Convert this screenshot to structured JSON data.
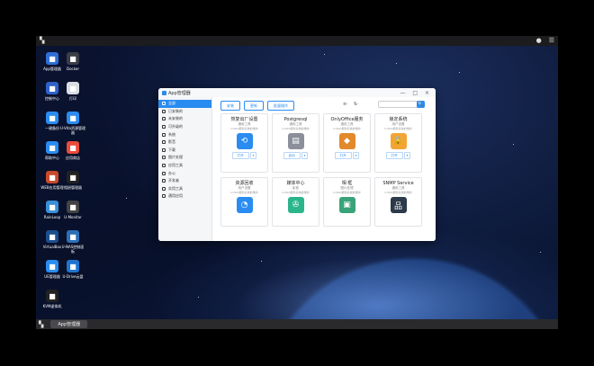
{
  "topbar": {
    "menu_icon": "apps-grid-icon",
    "user_icon": "user-icon",
    "list_icon": "list-icon"
  },
  "desktop_icons": [
    {
      "label": "App管理器",
      "icon": "app-store-icon",
      "color": "#2f6fd6"
    },
    {
      "label": "Docker",
      "icon": "docker-icon",
      "color": "#3a3f46"
    },
    {
      "label": "控制中心",
      "icon": "control-center-icon",
      "color": "#2e62c9"
    },
    {
      "label": "打印",
      "icon": "printer-icon",
      "color": "#d9dde3"
    },
    {
      "label": "一键备份",
      "icon": "backup-icon",
      "color": "#2a8cf0"
    },
    {
      "label": "U-Vita资源管理器",
      "icon": "file-manager-icon",
      "color": "#2a8cf0"
    },
    {
      "label": "帮助中心",
      "icon": "help-icon",
      "color": "#2a8cf0"
    },
    {
      "label": "应用商店",
      "icon": "store-icon",
      "color": "#e94b3c"
    },
    {
      "label": "WEB应用管理",
      "icon": "web-icon",
      "color": "#c94a2b"
    },
    {
      "label": "相册管理器",
      "icon": "photos-icon",
      "color": "#222"
    },
    {
      "label": "RainLoop",
      "icon": "mail-icon",
      "color": "#3a8fd8"
    },
    {
      "label": "U-Monitor",
      "icon": "monitor-icon",
      "color": "#444"
    },
    {
      "label": "VirtualBox",
      "icon": "virtualbox-icon",
      "color": "#1b4f8f"
    },
    {
      "label": "U-NAS控制面板",
      "icon": "panel-icon",
      "color": "#2c6fb8"
    },
    {
      "label": "UE管理器",
      "icon": "ue-icon",
      "color": "#2a8cf0"
    },
    {
      "label": "U-Drive云盘",
      "icon": "cloud-icon",
      "color": "#1f74d0"
    },
    {
      "label": "KVM虚拟机",
      "icon": "kvm-icon",
      "color": "#222"
    }
  ],
  "window": {
    "title": "App管理器",
    "controls": "— □ ×"
  },
  "sidebar": [
    {
      "label": "全部"
    },
    {
      "label": "已安装的"
    },
    {
      "label": "未安装的"
    },
    {
      "label": "可升级的"
    },
    {
      "label": "系统"
    },
    {
      "label": "影音"
    },
    {
      "label": "下载"
    },
    {
      "label": "图片处理"
    },
    {
      "label": "应用工具"
    },
    {
      "label": "办公"
    },
    {
      "label": "开发者"
    },
    {
      "label": "实用工具"
    },
    {
      "label": "通用应用"
    }
  ],
  "tabs": [
    {
      "label": "安装"
    },
    {
      "label": "更新"
    },
    {
      "label": "批量操作"
    }
  ],
  "sort_icons": {
    "sort": "≡·",
    "updown": "⇅·"
  },
  "search": {
    "placeholder": "",
    "button": "🔍"
  },
  "cards": [
    {
      "name": "恢复出厂设置",
      "category": "通用工具",
      "desc": "U-NAS服务系统的维护",
      "icon": "factory-reset-icon",
      "color": "#2a8cf0",
      "glyph": "⟲",
      "action": "打开"
    },
    {
      "name": "Postgresql",
      "category": "通用工具",
      "desc": "U-NAS服务系统的维护",
      "icon": "database-icon",
      "color": "#8a8f99",
      "glyph": "▤",
      "action": "启动"
    },
    {
      "name": "OnlyOffice服务",
      "category": "通用工具",
      "desc": "U-NAS服务系统的维护",
      "icon": "onlyoffice-icon",
      "color": "#e2892c",
      "glyph": "◆",
      "action": "打开"
    },
    {
      "name": "锁定系统",
      "category": "用户设置",
      "desc": "U-NAS服务系统的维护",
      "icon": "lock-icon",
      "color": "#f3a534",
      "glyph": "🔒",
      "action": "打开"
    },
    {
      "name": "资源回收",
      "category": "用户设置",
      "desc": "U-NAS服务系统的维护",
      "icon": "recycle-icon",
      "color": "#2a8cf0",
      "glyph": "◔",
      "action": ""
    },
    {
      "name": "媒体中心",
      "category": "影音",
      "desc": "U-NAS服务系统的维护",
      "icon": "media-center-icon",
      "color": "#2bb58a",
      "glyph": "✇",
      "action": ""
    },
    {
      "name": "相 框",
      "category": "图片处理",
      "desc": "U-NAS服务系统的维护",
      "icon": "photo-frame-icon",
      "color": "#3aa37a",
      "glyph": "▣",
      "action": ""
    },
    {
      "name": "SNMP Service",
      "category": "通用工具",
      "desc": "U-NAS服务系统的维护",
      "icon": "snmp-icon",
      "color": "#2d3a4a",
      "glyph": "品",
      "action": ""
    }
  ],
  "taskbar": {
    "start_icon": "start-icon",
    "task": "App管理器"
  }
}
